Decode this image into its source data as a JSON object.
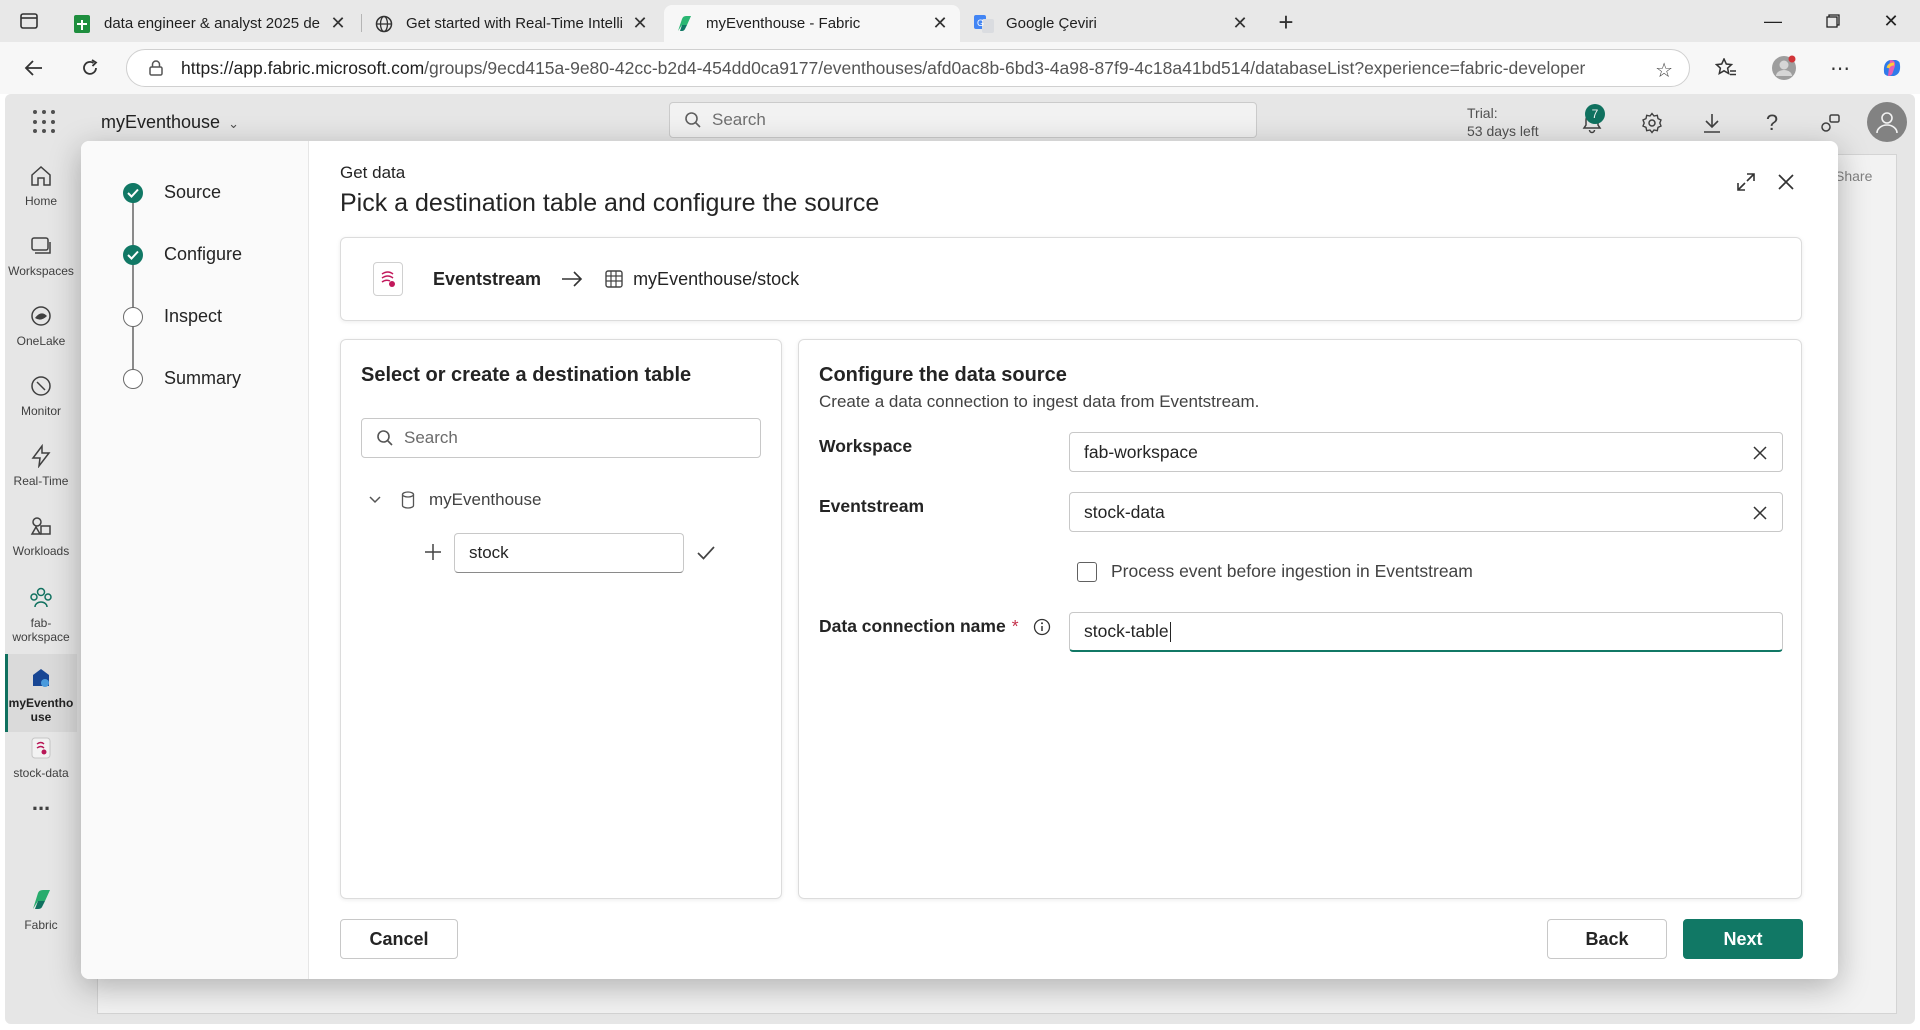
{
  "browser": {
    "tabs": [
      {
        "title": "data engineer & analyst 2025 der",
        "icon": "sheets-icon"
      },
      {
        "title": "Get started with Real-Time Intellig",
        "icon": "globe-icon"
      },
      {
        "title": "myEventhouse - Fabric",
        "icon": "fabric-icon",
        "active": true
      },
      {
        "title": "Google Çeviri",
        "icon": "translate-icon"
      }
    ],
    "url_host": "https://app.fabric.microsoft.com",
    "url_path": "/groups/9ecd415a-9e80-42cc-b2d4-454dd0ca9177/eventhouses/afd0ac8b-6bd3-4a98-87f9-4c18a41bd514/databaseList?experience=fabric-developer"
  },
  "app": {
    "name": "myEventhouse",
    "search_placeholder": "Search",
    "trial_line1": "Trial:",
    "trial_line2": "53 days left",
    "notification_count": "7",
    "share_label": "Share",
    "brand_color": "#117865",
    "nav": [
      {
        "label": "Home",
        "icon": "home-icon"
      },
      {
        "label": "Workspaces",
        "icon": "workspaces-icon"
      },
      {
        "label": "OneLake",
        "icon": "onelake-icon"
      },
      {
        "label": "Monitor",
        "icon": "monitor-icon"
      },
      {
        "label": "Real-Time",
        "icon": "lightning-icon"
      },
      {
        "label": "Workloads",
        "icon": "workloads-icon"
      },
      {
        "label_line1": "fab-",
        "label_line2": "workspace",
        "icon": "workspace-people-icon"
      },
      {
        "label_line1": "myEventho",
        "label_line2": "use",
        "icon": "eventhouse-icon",
        "active": true
      },
      {
        "label": "stock-data",
        "icon": "eventstream-icon"
      },
      {
        "label": "...",
        "icon": "more-icon"
      }
    ],
    "footer_label": "Fabric"
  },
  "dialog": {
    "subtitle": "Get data",
    "title": "Pick a destination table and configure the source",
    "steps": [
      {
        "label": "Source",
        "done": true
      },
      {
        "label": "Configure",
        "done": true
      },
      {
        "label": "Inspect",
        "done": false
      },
      {
        "label": "Summary",
        "done": false
      }
    ],
    "flow": {
      "source": "Eventstream",
      "destination": "myEventhouse/stock"
    },
    "left": {
      "header": "Select or create a destination table",
      "search_placeholder": "Search",
      "database": "myEventhouse",
      "new_table_value": "stock"
    },
    "right": {
      "header": "Configure the data source",
      "description": "Create a data connection to ingest data from Eventstream.",
      "workspace_label": "Workspace",
      "workspace_value": "fab-workspace",
      "eventstream_label": "Eventstream",
      "eventstream_value": "stock-data",
      "process_checkbox_label": "Process event before ingestion in Eventstream",
      "connection_label": "Data connection name",
      "required_mark": "*",
      "connection_value": "stock-table"
    },
    "buttons": {
      "cancel": "Cancel",
      "back": "Back",
      "next": "Next"
    }
  }
}
